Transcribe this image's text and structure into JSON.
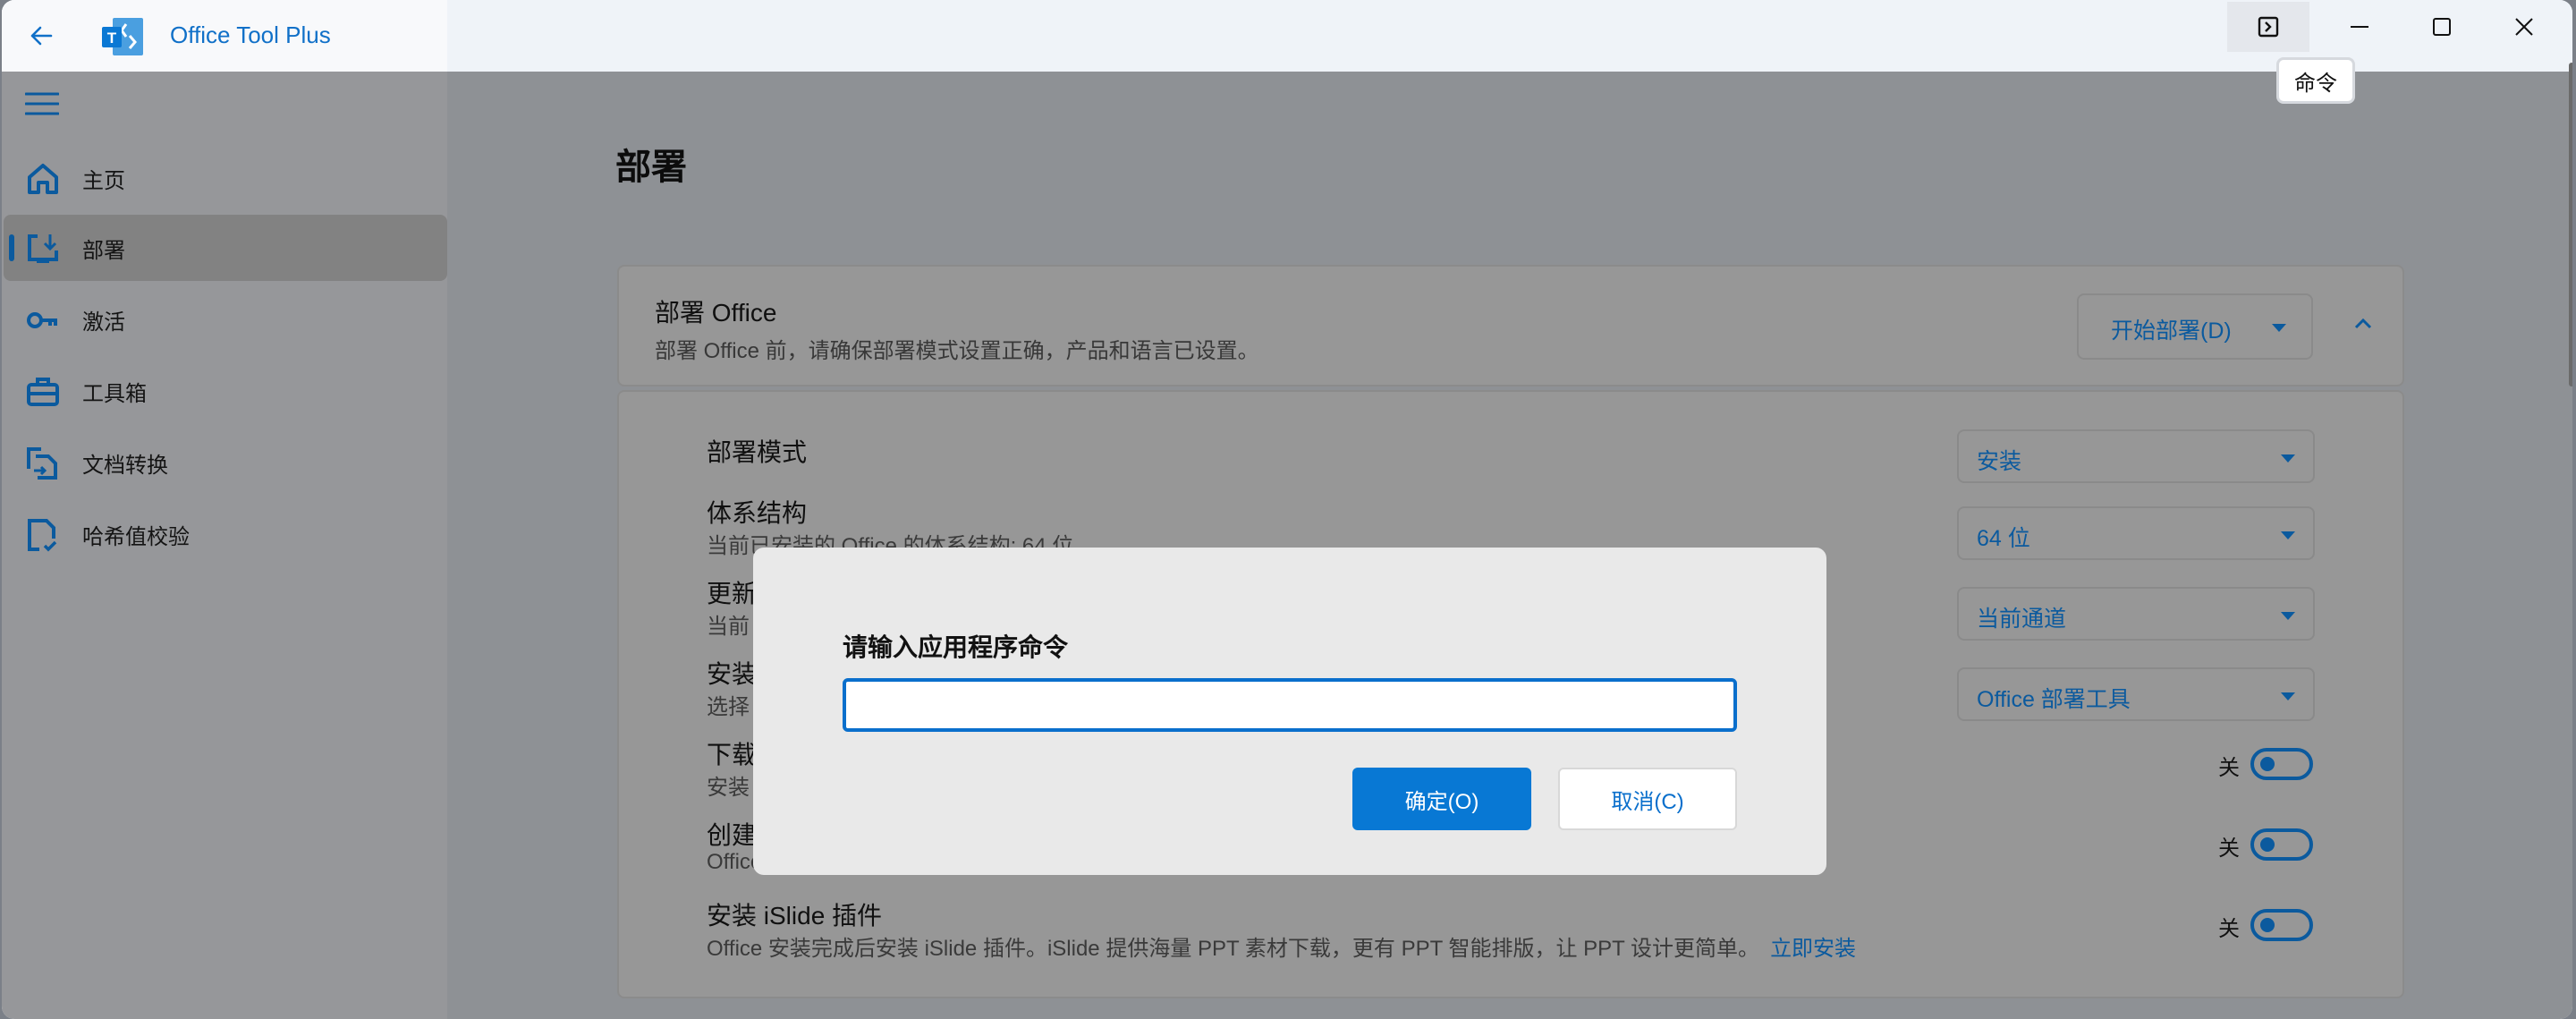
{
  "titlebar": {
    "app_title": "Office Tool Plus",
    "command_tooltip": "命令",
    "icons": {
      "back": "arrow-left-icon",
      "command": "console-icon",
      "minimize": "minimize-icon",
      "maximize": "maximize-icon",
      "close": "close-icon"
    }
  },
  "sidebar": {
    "items": [
      {
        "label": "主页",
        "icon": "home-icon",
        "selected": false
      },
      {
        "label": "部署",
        "icon": "deploy-icon",
        "selected": true
      },
      {
        "label": "激活",
        "icon": "key-icon",
        "selected": false
      },
      {
        "label": "工具箱",
        "icon": "toolbox-icon",
        "selected": false
      },
      {
        "label": "文档转换",
        "icon": "document-convert-icon",
        "selected": false
      },
      {
        "label": "哈希值校验",
        "icon": "file-check-icon",
        "selected": false
      }
    ]
  },
  "page": {
    "title": "部署",
    "deploy_card": {
      "title": "部署 Office",
      "description": "部署 Office 前，请确保部署模式设置正确，产品和语言已设置。",
      "start_button": "开始部署(D)",
      "start_button_accesskey": "D"
    },
    "settings": [
      {
        "label": "部署模式",
        "description": "",
        "control": "dropdown",
        "value": "安装"
      },
      {
        "label": "体系结构",
        "description": "当前已安装的 Office 的体系结构: 64 位",
        "control": "dropdown",
        "value": "64 位"
      },
      {
        "label": "更新",
        "description": "当前",
        "control": "dropdown",
        "value": "当前通道"
      },
      {
        "label": "安装",
        "description": "选择",
        "control": "dropdown",
        "value": "Office 部署工具"
      },
      {
        "label": "下载",
        "description": "安装",
        "control": "toggle",
        "state_label": "关",
        "on": false
      },
      {
        "label": "创建",
        "description": "Office",
        "control": "toggle",
        "state_label": "关",
        "on": false
      },
      {
        "label": "安装 iSlide 插件",
        "description": "Office 安装完成后安装 iSlide 插件。iSlide 提供海量 PPT 素材下载，更有 PPT 智能排版，让 PPT 设计更简单。",
        "link": "立即安装",
        "control": "toggle",
        "state_label": "关",
        "on": false
      }
    ]
  },
  "dialog": {
    "title": "请输入应用程序命令",
    "input_value": "",
    "ok_label": "确定(O)",
    "cancel_label": "取消(C)"
  },
  "colors": {
    "accent": "#0878d4",
    "accent_dim": "#0b5a9e",
    "title_text": "#1070c8",
    "dialog_bg": "#e9e9e9"
  }
}
